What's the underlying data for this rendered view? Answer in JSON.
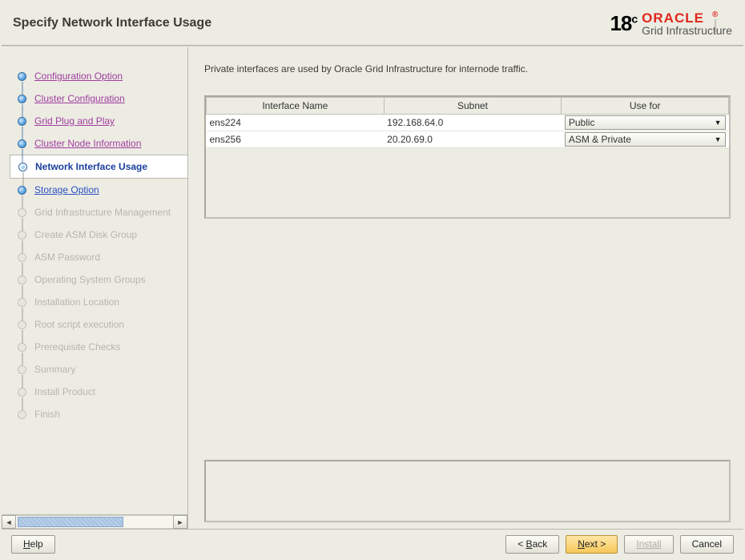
{
  "header": {
    "title": "Specify Network Interface Usage",
    "brand_version": "18",
    "brand_version_suffix": "c",
    "brand_name": "ORACLE",
    "brand_tag": "Grid Infrastructure"
  },
  "sidebar": {
    "steps": [
      {
        "label": "Configuration Option",
        "state": "completed"
      },
      {
        "label": "Cluster Configuration",
        "state": "completed"
      },
      {
        "label": "Grid Plug and Play",
        "state": "completed"
      },
      {
        "label": "Cluster Node Information",
        "state": "completed"
      },
      {
        "label": "Network Interface Usage",
        "state": "current"
      },
      {
        "label": "Storage Option",
        "state": "upcoming"
      },
      {
        "label": "Grid Infrastructure Management",
        "state": "disabled"
      },
      {
        "label": "Create ASM Disk Group",
        "state": "disabled"
      },
      {
        "label": "ASM Password",
        "state": "disabled"
      },
      {
        "label": "Operating System Groups",
        "state": "disabled"
      },
      {
        "label": "Installation Location",
        "state": "disabled"
      },
      {
        "label": "Root script execution",
        "state": "disabled"
      },
      {
        "label": "Prerequisite Checks",
        "state": "disabled"
      },
      {
        "label": "Summary",
        "state": "disabled"
      },
      {
        "label": "Install Product",
        "state": "disabled"
      },
      {
        "label": "Finish",
        "state": "disabled"
      }
    ]
  },
  "main": {
    "description": "Private interfaces are used by Oracle Grid Infrastructure for internode traffic.",
    "columns": [
      "Interface Name",
      "Subnet",
      "Use for"
    ],
    "rows": [
      {
        "iface": "ens224",
        "subnet": "192.168.64.0",
        "use": "Public"
      },
      {
        "iface": "ens256",
        "subnet": "20.20.69.0",
        "use": "ASM & Private"
      }
    ]
  },
  "footer": {
    "help": "Help",
    "back": "< Back",
    "next": "Next >",
    "install": "Install",
    "cancel": "Cancel"
  }
}
